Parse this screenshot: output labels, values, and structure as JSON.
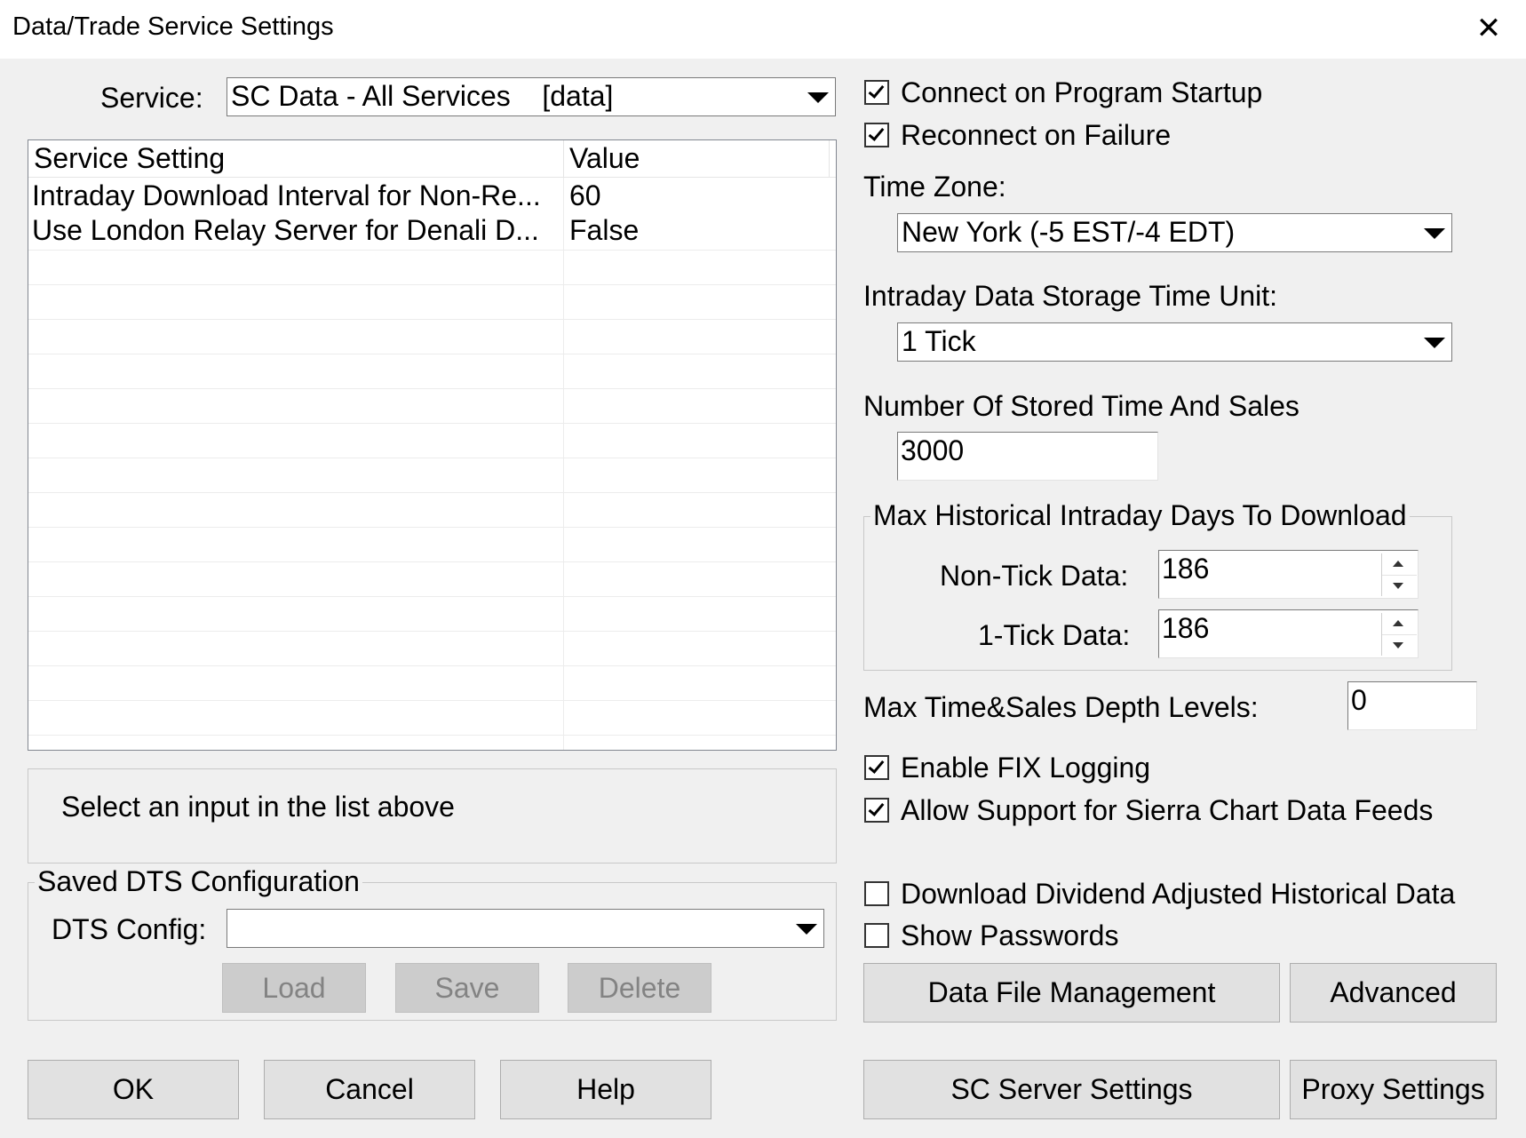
{
  "window": {
    "title": "Data/Trade Service Settings",
    "close_glyph": "✕"
  },
  "service": {
    "label": "Service:",
    "value": "SC Data - All Services    [data]"
  },
  "settings_list": {
    "col_setting": "Service Setting",
    "col_value": "Value",
    "rows": [
      {
        "setting": "Intraday Download Interval for Non-Re...",
        "value": "60"
      },
      {
        "setting": "Use London Relay Server for Denali D...",
        "value": "False"
      }
    ]
  },
  "description": "Select an input in the list above",
  "saved_dts": {
    "group_title": "Saved DTS Configuration",
    "config_label": "DTS Config:",
    "config_value": "",
    "load": "Load",
    "save": "Save",
    "delete": "Delete"
  },
  "bottom_buttons": {
    "ok": "OK",
    "cancel": "Cancel",
    "help": "Help"
  },
  "options": {
    "connect_on_startup": {
      "label": "Connect on Program Startup",
      "checked": true
    },
    "reconnect_on_failure": {
      "label": "Reconnect on Failure",
      "checked": true
    },
    "time_zone_label": "Time Zone:",
    "time_zone_value": "New York (-5 EST/-4 EDT)",
    "storage_unit_label": "Intraday Data Storage Time Unit:",
    "storage_unit_value": "1 Tick",
    "stored_ts_label": "Number Of Stored Time And Sales",
    "stored_ts_value": "3000",
    "max_hist_group": "Max Historical Intraday Days To Download",
    "non_tick_label": "Non-Tick Data:",
    "non_tick_value": "186",
    "one_tick_label": "1-Tick Data:",
    "one_tick_value": "186",
    "depth_label": "Max Time&Sales Depth Levels:",
    "depth_value": "0",
    "enable_fix_logging": {
      "label": "Enable FIX Logging",
      "checked": true
    },
    "allow_sc_feeds": {
      "label": "Allow Support for Sierra Chart Data Feeds",
      "checked": true
    },
    "dividend_adjusted": {
      "label": "Download Dividend Adjusted Historical Data",
      "checked": false
    },
    "show_passwords": {
      "label": "Show Passwords",
      "checked": false
    }
  },
  "right_buttons": {
    "data_file_management": "Data File Management",
    "advanced": "Advanced",
    "sc_server_settings": "SC Server Settings",
    "proxy_settings": "Proxy Settings"
  }
}
